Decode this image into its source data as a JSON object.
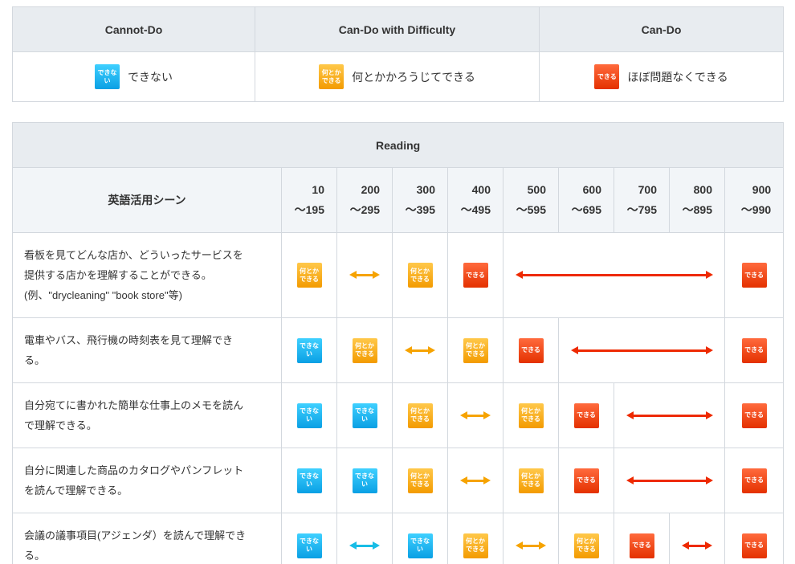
{
  "legend": {
    "headers": [
      "Cannot-Do",
      "Can-Do with Difficulty",
      "Can-Do"
    ],
    "cells": [
      {
        "badge": [
          "できない"
        ],
        "color": "blue",
        "label": "できない"
      },
      {
        "badge": [
          "何とか",
          "できる"
        ],
        "color": "yellow",
        "label": "何とかかろうじてできる"
      },
      {
        "badge": [
          "できる"
        ],
        "color": "red",
        "label": "ほぼ問題なくできる"
      }
    ]
  },
  "reading": {
    "title": "Reading",
    "scene_header": "英語活用シーン",
    "score_ranges": [
      {
        "from": "10",
        "to": "〜195"
      },
      {
        "from": "200",
        "to": "〜295"
      },
      {
        "from": "300",
        "to": "〜395"
      },
      {
        "from": "400",
        "to": "〜495"
      },
      {
        "from": "500",
        "to": "〜595"
      },
      {
        "from": "600",
        "to": "〜695"
      },
      {
        "from": "700",
        "to": "〜795"
      },
      {
        "from": "800",
        "to": "〜895"
      },
      {
        "from": "900",
        "to": "〜990"
      }
    ],
    "rows": [
      {
        "description": [
          "看板を見てどんな店か、どういったサービスを",
          "提供する店かを理解することができる。",
          "(例、\"drycleaning\" \"book store\"等)"
        ],
        "cells": [
          {
            "type": "badge",
            "color": "yellow",
            "text": [
              "何とか",
              "できる"
            ]
          },
          {
            "type": "arrow",
            "color": "orange",
            "span": 1
          },
          {
            "type": "badge",
            "color": "yellow",
            "text": [
              "何とか",
              "できる"
            ]
          },
          {
            "type": "badge",
            "color": "red",
            "text": [
              "できる"
            ]
          },
          {
            "type": "arrow",
            "color": "red",
            "span": 4
          },
          {
            "type": "badge",
            "color": "red",
            "text": [
              "できる"
            ]
          }
        ]
      },
      {
        "description": [
          "電車やバス、飛行機の時刻表を見て理解でき",
          "る。"
        ],
        "cells": [
          {
            "type": "badge",
            "color": "blue",
            "text": [
              "できない"
            ]
          },
          {
            "type": "badge",
            "color": "yellow",
            "text": [
              "何とか",
              "できる"
            ]
          },
          {
            "type": "arrow",
            "color": "orange",
            "span": 1
          },
          {
            "type": "badge",
            "color": "yellow",
            "text": [
              "何とか",
              "できる"
            ]
          },
          {
            "type": "badge",
            "color": "red",
            "text": [
              "できる"
            ]
          },
          {
            "type": "arrow",
            "color": "red",
            "span": 3
          },
          {
            "type": "badge",
            "color": "red",
            "text": [
              "できる"
            ]
          }
        ]
      },
      {
        "description": [
          "自分宛てに書かれた簡単な仕事上のメモを読ん",
          "で理解できる。"
        ],
        "cells": [
          {
            "type": "badge",
            "color": "blue",
            "text": [
              "できない"
            ]
          },
          {
            "type": "badge",
            "color": "blue",
            "text": [
              "できない"
            ]
          },
          {
            "type": "badge",
            "color": "yellow",
            "text": [
              "何とか",
              "できる"
            ]
          },
          {
            "type": "arrow",
            "color": "orange",
            "span": 1
          },
          {
            "type": "badge",
            "color": "yellow",
            "text": [
              "何とか",
              "できる"
            ]
          },
          {
            "type": "badge",
            "color": "red",
            "text": [
              "できる"
            ]
          },
          {
            "type": "arrow",
            "color": "red",
            "span": 2
          },
          {
            "type": "badge",
            "color": "red",
            "text": [
              "できる"
            ]
          }
        ]
      },
      {
        "description": [
          "自分に関連した商品のカタログやパンフレット",
          "を読んで理解できる。"
        ],
        "cells": [
          {
            "type": "badge",
            "color": "blue",
            "text": [
              "できない"
            ]
          },
          {
            "type": "badge",
            "color": "blue",
            "text": [
              "できない"
            ]
          },
          {
            "type": "badge",
            "color": "yellow",
            "text": [
              "何とか",
              "できる"
            ]
          },
          {
            "type": "arrow",
            "color": "orange",
            "span": 1
          },
          {
            "type": "badge",
            "color": "yellow",
            "text": [
              "何とか",
              "できる"
            ]
          },
          {
            "type": "badge",
            "color": "red",
            "text": [
              "できる"
            ]
          },
          {
            "type": "arrow",
            "color": "red",
            "span": 2
          },
          {
            "type": "badge",
            "color": "red",
            "text": [
              "できる"
            ]
          }
        ]
      },
      {
        "description": [
          "会議の議事項目(アジェンダ）を読んで理解でき",
          "る。"
        ],
        "cells": [
          {
            "type": "badge",
            "color": "blue",
            "text": [
              "できない"
            ]
          },
          {
            "type": "arrow",
            "color": "cyan",
            "span": 1
          },
          {
            "type": "badge",
            "color": "blue",
            "text": [
              "できない"
            ]
          },
          {
            "type": "badge",
            "color": "yellow",
            "text": [
              "何とか",
              "できる"
            ]
          },
          {
            "type": "arrow",
            "color": "orange",
            "span": 1
          },
          {
            "type": "badge",
            "color": "yellow",
            "text": [
              "何とか",
              "できる"
            ]
          },
          {
            "type": "badge",
            "color": "red",
            "text": [
              "できる"
            ]
          },
          {
            "type": "arrow",
            "color": "red",
            "span": 1
          },
          {
            "type": "badge",
            "color": "red",
            "text": [
              "できる"
            ]
          }
        ]
      }
    ]
  }
}
